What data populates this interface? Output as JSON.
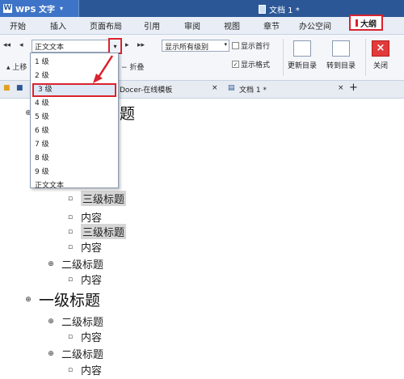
{
  "titlebar": {
    "app_name": "WPS 文字",
    "doc_title": "文档 1 *"
  },
  "menu": {
    "tabs": [
      "开始",
      "插入",
      "页面布局",
      "引用",
      "审阅",
      "视图",
      "章节",
      "办公空间"
    ],
    "active_tab": "大纲"
  },
  "ribbon": {
    "level_combo_value": "正文文本",
    "show_level_value": "显示所有级别",
    "show_first_line_label": "显示首行",
    "show_format_label": "显示格式",
    "show_format_checked": "✓",
    "update_toc_label": "更新目录",
    "goto_toc_label": "转到目录",
    "close_label": "关闭",
    "promote_label": "上移",
    "collapse_label": "折叠",
    "combo_arrow": "▾"
  },
  "doc_tabs": {
    "template_tab": "Docer-在线模板",
    "doc_tab": "文档 1 *",
    "add_tab": "+"
  },
  "dropdown": {
    "items": [
      "1 级",
      "2 级",
      "3 级",
      "4 级",
      "5 级",
      "6 级",
      "7 级",
      "8 级",
      "9 级",
      "正文文本"
    ],
    "selected_index": 2
  },
  "outline": {
    "top_heading_partial": "题",
    "rows": [
      {
        "level": 3,
        "text": "三级标题",
        "highlight": true
      },
      {
        "level": "body3",
        "text": "内容"
      },
      {
        "level": 3,
        "text": "三级标题",
        "highlight": true
      },
      {
        "level": "body3",
        "text": "内容"
      },
      {
        "level": 2,
        "text": "二级标题"
      },
      {
        "level": "body2",
        "text": "内容"
      },
      {
        "level": 1,
        "text": "一级标题"
      },
      {
        "level": 2,
        "text": "二级标题"
      },
      {
        "level": "body2",
        "text": "内容"
      },
      {
        "level": 2,
        "text": "二级标题"
      },
      {
        "level": "body2",
        "text": "内容"
      }
    ]
  },
  "colors": {
    "accent_red": "#d9232e",
    "titlebar_blue": "#2b5797"
  }
}
